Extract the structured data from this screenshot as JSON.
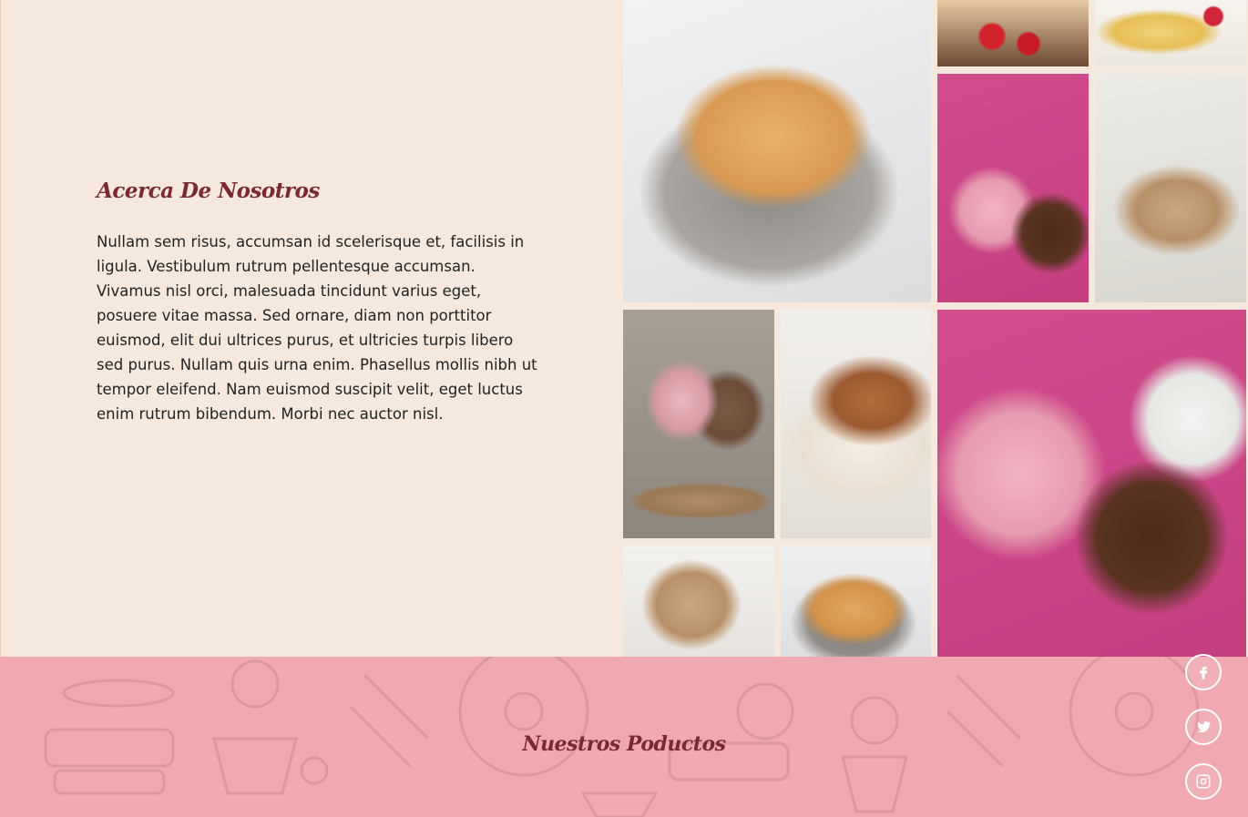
{
  "about": {
    "title": "Acerca De Nosotros",
    "body": "Nullam sem risus, accumsan id scelerisque et, facilisis in ligula. Vestibulum rutrum pellentesque accumsan. Vivamus nisl orci, malesuada tincidunt varius eget, posuere vitae massa. Sed ornare, diam non porttitor euismod, elit dui ultrices purus, et ultricies turpis libero sed purus. Nullam quis urna enim. Phasellus mollis nibh ut tempor eleifend. Nam euismod suscipit velit, eget luctus enim rutrum bibendum. Morbi nec auctor nisl."
  },
  "gallery": {
    "images": [
      {
        "subject": "empanada"
      },
      {
        "subject": "strawberry-roll"
      },
      {
        "subject": "crepes-raspberries"
      },
      {
        "subject": "cake-pops"
      },
      {
        "subject": "mousse-cup"
      },
      {
        "subject": "cupcakes"
      },
      {
        "subject": "tiramisu"
      },
      {
        "subject": "cake-pops"
      },
      {
        "subject": "mousse-cup"
      },
      {
        "subject": "empanadas"
      }
    ]
  },
  "products": {
    "title": "Nuestros Poductos"
  },
  "social": {
    "icons": [
      "facebook-icon",
      "twitter-icon",
      "instagram-icon"
    ]
  },
  "colors": {
    "background": "#f6e8dc",
    "heading": "#7a2a2e",
    "footer": "#f0aaaf"
  }
}
